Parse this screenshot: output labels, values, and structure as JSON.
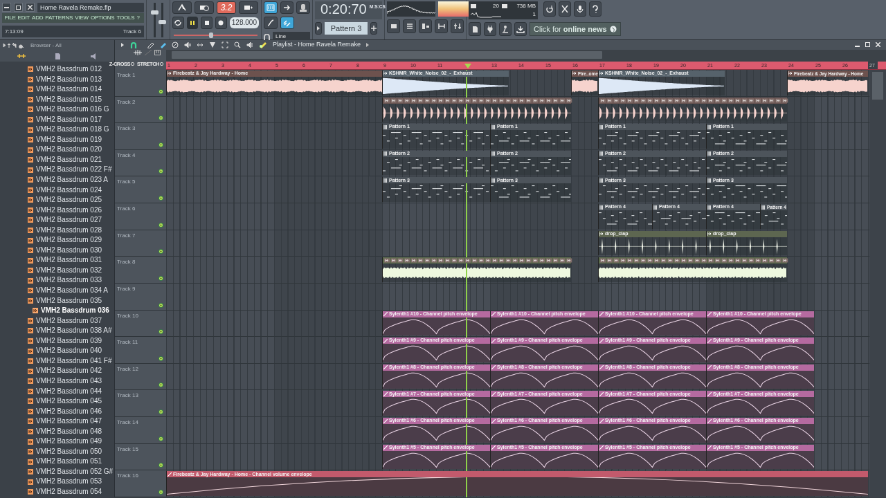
{
  "window": {
    "title": "Home Ravela Remake.flp",
    "menu": [
      "FILE",
      "EDIT",
      "ADD",
      "PATTERNS",
      "VIEW",
      "OPTIONS",
      "TOOLS",
      "?"
    ],
    "time": "7:13:09",
    "hint": "Track 6"
  },
  "master": {
    "volume": {
      "level": 0.72
    },
    "pitch": {
      "level": 0.45
    }
  },
  "transport": {
    "step_display": "3.2",
    "playing": true,
    "tempo": "128.000",
    "position": {
      "level": 0.45
    },
    "time": "0:20:70",
    "time_units": "M:S:CS",
    "snap": "Line",
    "pattern": "Pattern 3",
    "cpu": "20",
    "memory": "738 MB",
    "polyphony": "1",
    "news": "Click for **online news**"
  },
  "browser": {
    "title": "Browser - All",
    "items": [
      {
        "label": "VMH2 Bassdrum 012",
        "selected": false
      },
      {
        "label": "VMH2 Bassdrum 013",
        "selected": false
      },
      {
        "label": "VMH2 Bassdrum 014",
        "selected": false
      },
      {
        "label": "VMH2 Bassdrum 015",
        "selected": false
      },
      {
        "label": "VMH2 Bassdrum 016 G",
        "selected": false
      },
      {
        "label": "VMH2 Bassdrum 017",
        "selected": false
      },
      {
        "label": "VMH2 Bassdrum 018 G",
        "selected": false
      },
      {
        "label": "VMH2 Bassdrum 019",
        "selected": false
      },
      {
        "label": "VMH2 Bassdrum 020",
        "selected": false
      },
      {
        "label": "VMH2 Bassdrum 021",
        "selected": false
      },
      {
        "label": "VMH2 Bassdrum 022 F#",
        "selected": false
      },
      {
        "label": "VMH2 Bassdrum 023 A",
        "selected": false
      },
      {
        "label": "VMH2 Bassdrum 024",
        "selected": false
      },
      {
        "label": "VMH2 Bassdrum 025",
        "selected": false
      },
      {
        "label": "VMH2 Bassdrum 026",
        "selected": false
      },
      {
        "label": "VMH2 Bassdrum 027",
        "selected": false
      },
      {
        "label": "VMH2 Bassdrum 028",
        "selected": false
      },
      {
        "label": "VMH2 Bassdrum 029",
        "selected": false
      },
      {
        "label": "VMH2 Bassdrum 030",
        "selected": false
      },
      {
        "label": "VMH2 Bassdrum 031",
        "selected": false
      },
      {
        "label": "VMH2 Bassdrum 032",
        "selected": false
      },
      {
        "label": "VMH2 Bassdrum 033",
        "selected": false
      },
      {
        "label": "VMH2 Bassdrum 034 A",
        "selected": false
      },
      {
        "label": "VMH2 Bassdrum 035",
        "selected": false
      },
      {
        "label": "VMH2 Bassdrum 036",
        "selected": true
      },
      {
        "label": "VMH2 Bassdrum 037",
        "selected": false
      },
      {
        "label": "VMH2 Bassdrum 038 A#",
        "selected": false
      },
      {
        "label": "VMH2 Bassdrum 039",
        "selected": false
      },
      {
        "label": "VMH2 Bassdrum 040",
        "selected": false
      },
      {
        "label": "VMH2 Bassdrum 041 F#",
        "selected": false
      },
      {
        "label": "VMH2 Bassdrum 042",
        "selected": false
      },
      {
        "label": "VMH2 Bassdrum 043",
        "selected": false
      },
      {
        "label": "VMH2 Bassdrum 044",
        "selected": false
      },
      {
        "label": "VMH2 Bassdrum 045",
        "selected": false
      },
      {
        "label": "VMH2 Bassdrum 046",
        "selected": false
      },
      {
        "label": "VMH2 Bassdrum 047",
        "selected": false
      },
      {
        "label": "VMH2 Bassdrum 048",
        "selected": false
      },
      {
        "label": "VMH2 Bassdrum 049",
        "selected": false
      },
      {
        "label": "VMH2 Bassdrum 050",
        "selected": false
      },
      {
        "label": "VMH2 Bassdrum 051",
        "selected": false
      },
      {
        "label": "VMH2 Bassdrum 052 G#",
        "selected": false
      },
      {
        "label": "VMH2 Bassdrum 053",
        "selected": false
      },
      {
        "label": "VMH2 Bassdrum 054",
        "selected": false
      }
    ]
  },
  "playlist": {
    "title": "Playlist - Home Ravela Remake",
    "zcross": "Z-CROSS",
    "stretch": "STRETCH",
    "ruler": [
      {
        "label": "1"
      },
      {
        "label": "2"
      },
      {
        "label": "3"
      },
      {
        "label": "4"
      },
      {
        "label": "5"
      },
      {
        "label": "6"
      },
      {
        "label": "7"
      },
      {
        "label": "8"
      },
      {
        "label": "9"
      },
      {
        "label": "10"
      },
      {
        "label": "11"
      },
      {
        "kind": "playhead"
      },
      {
        "label": "13"
      },
      {
        "label": "14"
      },
      {
        "label": "15"
      },
      {
        "label": "16"
      },
      {
        "label": "17"
      },
      {
        "label": "18"
      },
      {
        "label": "19"
      },
      {
        "label": "20"
      },
      {
        "label": "21"
      },
      {
        "label": "22"
      },
      {
        "label": "23"
      },
      {
        "label": "24"
      },
      {
        "label": "25"
      },
      {
        "label": "26"
      },
      {
        "label": "27"
      }
    ],
    "tracks": [
      {
        "name": "Track 1",
        "active": true,
        "clips": [
          {
            "kind": "audio",
            "label": "Firebeatz & Jay Hardway - Home"
          },
          {
            "kind": "noise",
            "label": "KSHMR_White_Noise_02_-_Exhaust"
          },
          {
            "kind": "audio",
            "label": "Fire..ome"
          },
          {
            "kind": "noise",
            "label": "KSHMR_White_Noise_02_-_Exhaust"
          },
          {
            "kind": "audio",
            "label": "Firebeatz & Jay Hardway - Home"
          }
        ]
      },
      {
        "name": "Track 2",
        "active": true,
        "clips": [
          {
            "kind": "beats"
          },
          {
            "kind": "beats"
          }
        ]
      },
      {
        "name": "Track 3",
        "active": true,
        "clips": [
          {
            "kind": "pattern",
            "label": "Pattern 1"
          },
          {
            "kind": "pattern",
            "label": "Pattern 1"
          },
          {
            "kind": "pattern",
            "label": "Pattern 1"
          },
          {
            "kind": "pattern",
            "label": "Pattern 1"
          }
        ]
      },
      {
        "name": "Track 4",
        "active": true,
        "clips": [
          {
            "kind": "pattern",
            "label": "Pattern 2"
          },
          {
            "kind": "pattern",
            "label": "Pattern 2"
          },
          {
            "kind": "pattern",
            "label": "Pattern 2"
          },
          {
            "kind": "pattern",
            "label": "Pattern 2"
          }
        ]
      },
      {
        "name": "Track 5",
        "active": true,
        "clips": [
          {
            "kind": "pattern",
            "label": "Pattern 3"
          },
          {
            "kind": "pattern",
            "label": "Pattern 3"
          },
          {
            "kind": "pattern",
            "label": "Pattern 3"
          },
          {
            "kind": "pattern",
            "label": "Pattern 3"
          }
        ]
      },
      {
        "name": "Track 6",
        "active": true,
        "clips": [
          {
            "kind": "pattern",
            "label": "Pattern 4"
          },
          {
            "kind": "pattern",
            "label": "Pattern 4"
          },
          {
            "kind": "pattern",
            "label": "Pattern 4"
          },
          {
            "kind": "pattern",
            "label": "Pattern 4"
          }
        ]
      },
      {
        "name": "Track 7",
        "active": true,
        "clips": [
          {
            "kind": "clap",
            "label": "drop_clap"
          },
          {
            "kind": "clap",
            "label": "drop_clap"
          }
        ]
      },
      {
        "name": "Track 8",
        "active": true,
        "clips": [
          {
            "kind": "loop"
          },
          {
            "kind": "loop"
          }
        ]
      },
      {
        "name": "Track 9",
        "active": true
      },
      {
        "name": "Track 10",
        "active": true,
        "clips": [
          {
            "kind": "automation",
            "label": "Sylenth1 #10 - Channel pitch envelope"
          },
          {
            "kind": "automation",
            "label": "Sylenth1 #10 - Channel pitch envelope"
          },
          {
            "kind": "automation",
            "label": "Sylenth1 #10 - Channel pitch envelope"
          },
          {
            "kind": "automation",
            "label": "Sylenth1 #10 - Channel pitch envelope"
          }
        ]
      },
      {
        "name": "Track 11",
        "active": true,
        "clips": [
          {
            "kind": "automation",
            "label": "Sylenth1 #9 - Channel pitch envelope"
          },
          {
            "kind": "automation",
            "label": "Sylenth1 #9 - Channel pitch envelope"
          },
          {
            "kind": "automation",
            "label": "Sylenth1 #9 - Channel pitch envelope"
          },
          {
            "kind": "automation",
            "label": "Sylenth1 #9 - Channel pitch envelope"
          }
        ]
      },
      {
        "name": "Track 12",
        "active": true,
        "clips": [
          {
            "kind": "automation",
            "label": "Sylenth1 #8 - Channel pitch envelope"
          },
          {
            "kind": "automation",
            "label": "Sylenth1 #8 - Channel pitch envelope"
          },
          {
            "kind": "automation",
            "label": "Sylenth1 #8 - Channel pitch envelope"
          },
          {
            "kind": "automation",
            "label": "Sylenth1 #8 - Channel pitch envelope"
          }
        ]
      },
      {
        "name": "Track 13",
        "active": true,
        "clips": [
          {
            "kind": "automation",
            "label": "Sylenth1 #7 - Channel pitch envelope"
          },
          {
            "kind": "automation",
            "label": "Sylenth1 #7 - Channel pitch envelope"
          },
          {
            "kind": "automation",
            "label": "Sylenth1 #7 - Channel pitch envelope"
          },
          {
            "kind": "automation",
            "label": "Sylenth1 #7 - Channel pitch envelope"
          }
        ]
      },
      {
        "name": "Track 14",
        "active": true,
        "clips": [
          {
            "kind": "automation",
            "label": "Sylenth1 #6 - Channel pitch envelope"
          },
          {
            "kind": "automation",
            "label": "Sylenth1 #6 - Channel pitch envelope"
          },
          {
            "kind": "automation",
            "label": "Sylenth1 #6 - Channel pitch envelope"
          },
          {
            "kind": "automation",
            "label": "Sylenth1 #6 - Channel pitch envelope"
          }
        ]
      },
      {
        "name": "Track 15",
        "active": true,
        "clips": [
          {
            "kind": "automation",
            "label": "Sylenth1 #5 - Channel pitch envelope"
          },
          {
            "kind": "automation",
            "label": "Sylenth1 #5 - Channel pitch envelope"
          },
          {
            "kind": "automation",
            "label": "Sylenth1 #5 - Channel pitch envelope"
          },
          {
            "kind": "automation",
            "label": "Sylenth1 #5 - Channel pitch envelope"
          }
        ]
      },
      {
        "name": "Track 16",
        "active": true,
        "clips": [
          {
            "kind": "volume",
            "label": "Firebeatz & Jay Hardway - Home - Channel volume envelope"
          }
        ]
      }
    ]
  }
}
